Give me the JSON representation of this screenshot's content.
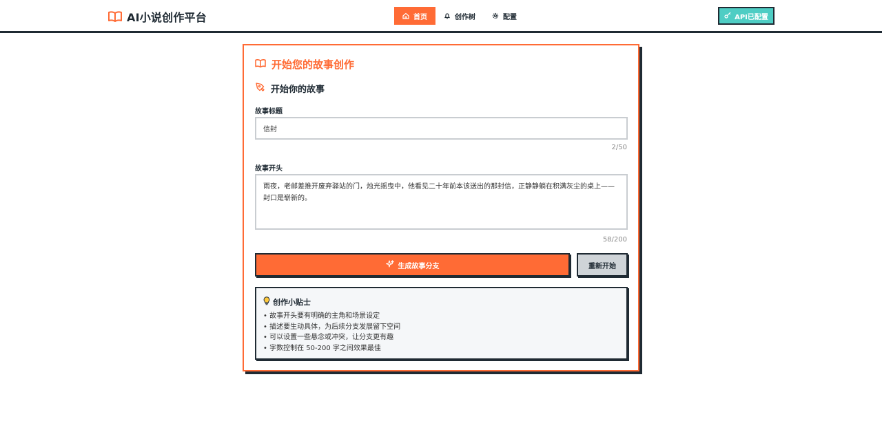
{
  "header": {
    "brand": "AI小说创作平台",
    "nav": [
      {
        "label": "首页",
        "icon": "home-icon",
        "active": true
      },
      {
        "label": "创作树",
        "icon": "bell-icon",
        "active": false
      },
      {
        "label": "配置",
        "icon": "gear-icon",
        "active": false
      }
    ],
    "api_button": "API已配置"
  },
  "card": {
    "title": "开始您的故事创作",
    "section_title": "开始你的故事",
    "title_field": {
      "label": "故事标题",
      "value": "信封",
      "counter": "2/50"
    },
    "opening_field": {
      "label": "故事开头",
      "value": "雨夜，老邮差推开废弃驿站的门，烛光摇曳中，他看见二十年前本该送出的那封信，正静静躺在积满灰尘的桌上——封口是崭新的。",
      "counter": "58/200"
    },
    "generate_button": "生成故事分支",
    "reset_button": "重新开始",
    "tips": {
      "title": "创作小贴士",
      "items": [
        "故事开头要有明确的主角和场景设定",
        "描述要生动具体，为后续分支发展留下空间",
        "可以设置一些悬念或冲突，让分支更有趣",
        "字数控制在 50-200 字之间效果最佳"
      ]
    }
  },
  "colors": {
    "accent": "#ff6b35",
    "teal": "#4ecdc4",
    "dark": "#1f2a33"
  }
}
